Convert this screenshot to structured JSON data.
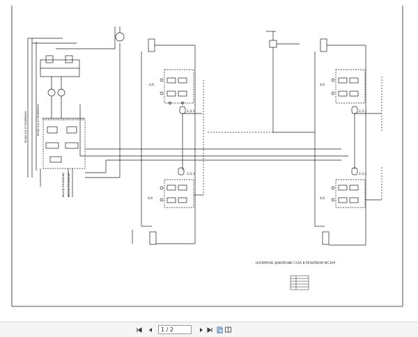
{
  "viewer": {
    "current_page": "1",
    "page_separator": "/",
    "total_pages": "2",
    "page_indicator": "1 / 2"
  },
  "drawing": {
    "title_line": "НАПОРНОЕ ДАВЛЕНИЕ ГАЗА В РЕЗЕРВУАР ИСЗАР",
    "valve_labels": {
      "group_a1": "4,6",
      "group_a2": "4,6",
      "group_b1": "4,6",
      "group_b2": "4,6",
      "acc_a1": "2,3,1",
      "acc_a2": "2,3,1",
      "acc_b1": "2,3,1",
      "acc_b2": "2,3,1"
    },
    "colors": {
      "line": "#1a1a1a",
      "dash": "#555555",
      "sheet": "#ffffff"
    }
  }
}
